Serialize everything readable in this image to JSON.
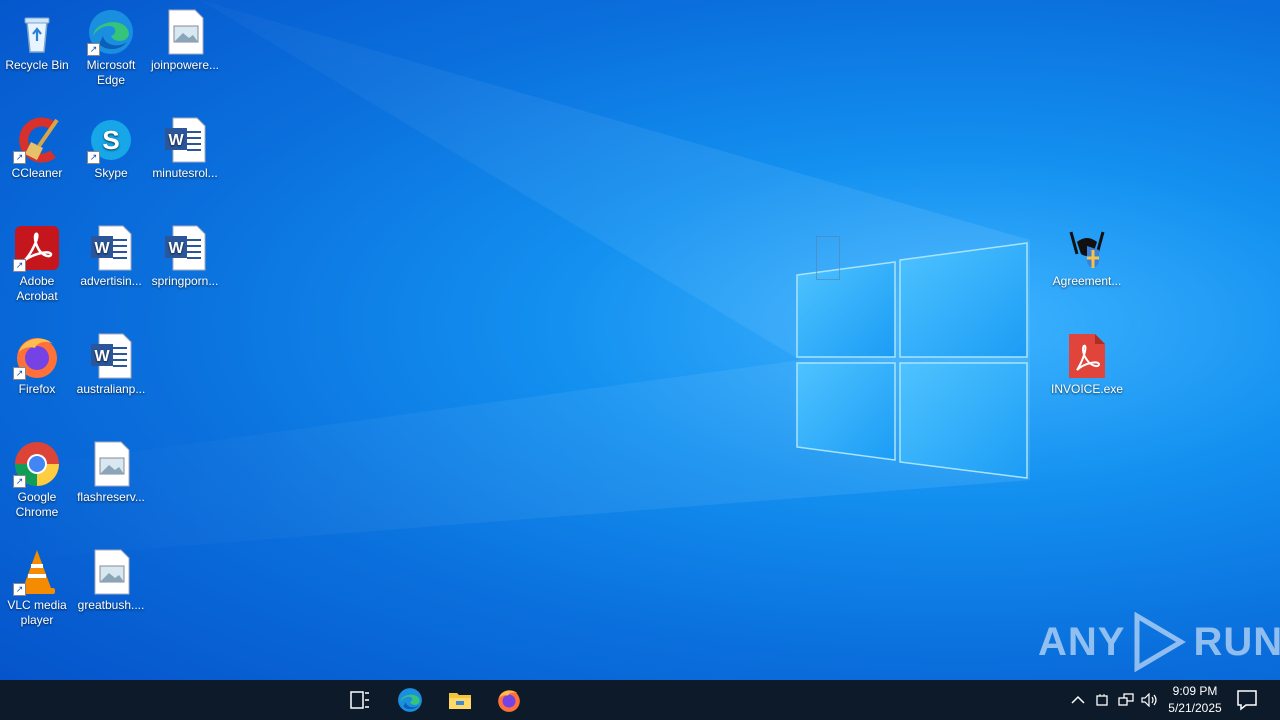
{
  "desktop": {
    "icons": [
      {
        "label": "Recycle Bin",
        "icon": "recycle-bin-icon"
      },
      {
        "label": "Microsoft Edge",
        "icon": "edge-icon"
      },
      {
        "label": "joinpowere...",
        "icon": "image-file-icon"
      },
      {
        "label": "CCleaner",
        "icon": "ccleaner-icon"
      },
      {
        "label": "Skype",
        "icon": "skype-icon"
      },
      {
        "label": "minutesrol...",
        "icon": "word-doc-icon"
      },
      {
        "label": "Adobe Acrobat",
        "icon": "acrobat-icon"
      },
      {
        "label": "advertisin...",
        "icon": "word-doc-icon"
      },
      {
        "label": "springporn...",
        "icon": "word-doc-icon"
      },
      {
        "label": "Firefox",
        "icon": "firefox-icon"
      },
      {
        "label": "australianp...",
        "icon": "word-doc-icon"
      },
      {
        "label": "Google Chrome",
        "icon": "chrome-icon"
      },
      {
        "label": "flashreserv...",
        "icon": "image-file-icon"
      },
      {
        "label": "VLC media player",
        "icon": "vlc-icon"
      },
      {
        "label": "greatbush....",
        "icon": "image-file-icon"
      },
      {
        "label": "Agreement...",
        "icon": "agreement-exe-icon"
      },
      {
        "label": "INVOICE.exe",
        "icon": "invoice-exe-icon"
      }
    ]
  },
  "watermark": {
    "left": "ANY",
    "right": "RUN"
  },
  "taskbar": {
    "buttons": [
      "task-view-icon",
      "edge-icon",
      "file-explorer-icon",
      "firefox-icon"
    ],
    "tray": [
      "chevron-up-icon",
      "device-icon",
      "network-icon",
      "volume-icon"
    ],
    "time": "9:09 PM",
    "date": "5/21/2025"
  },
  "colors": {
    "taskbar": "#0d1a2a",
    "desktop_accent": "#1390f0"
  }
}
